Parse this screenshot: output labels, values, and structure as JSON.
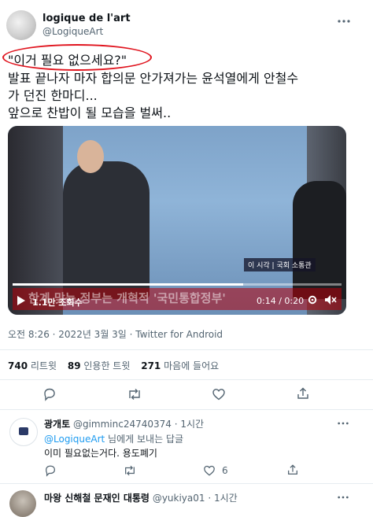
{
  "tweet": {
    "author_name": "logique de l'art",
    "author_handle": "@LogiqueArt",
    "quote_line": "\"이거 필요 없으세요?\"",
    "text_line1": "발표 끝나자 마자 합의문 안가져가는 윤석열에게 안철수",
    "text_line2": "가 던진 한마디...",
    "text_line3": "앞으로 찬밥이 될 모습을 벌써..",
    "timestamp": "오전 8:26 · 2022년 3월 3일 · Twitter for Android",
    "stats": {
      "retweets_count": "740",
      "retweets_label": "리트윗",
      "quotes_count": "89",
      "quotes_label": "인용한 트윗",
      "likes_count": "271",
      "likes_label": "마음에 들어요"
    }
  },
  "video": {
    "views": "1.1만 조회수",
    "time": "0:14 / 0:20",
    "caption": "한계 맞는 정부는 개혁적 '국민통합정부'",
    "live_badge": "이 시각 | 국회 소통관",
    "progress": 0.7
  },
  "reply1": {
    "name": "광개토",
    "handle": "@gimminc24740374",
    "time": "· 1시간",
    "replying_to_handle": "@LogiqueArt",
    "replying_to_suffix": " 님에게 보내는 답글",
    "text": "이미 필요없는거다. 용도폐기",
    "like_count": "6"
  },
  "reply2": {
    "name": "마왕 신해철 문재인 대통령",
    "handle": "@yukiya01",
    "time": "· 1시간"
  },
  "colors": {
    "accent": "#1d9bf0",
    "annotation_red": "#e0141e",
    "muted": "#536471"
  }
}
